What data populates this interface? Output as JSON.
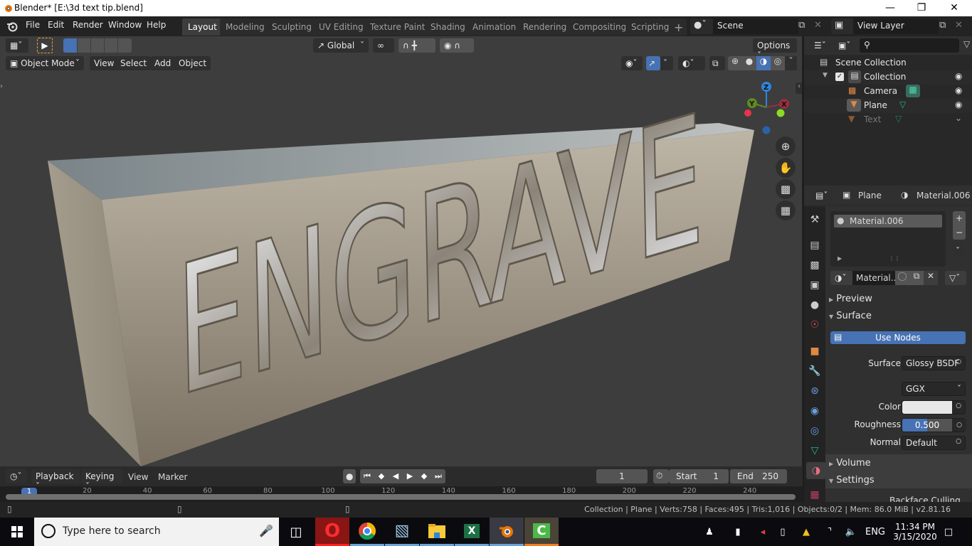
{
  "window": {
    "title": "Blender* [E:\\3d text tip.blend]",
    "minimize_icon": "minimize-icon",
    "maximize_icon": "restore-icon",
    "close_icon": "close-icon"
  },
  "topbar": {
    "menus": [
      "File",
      "Edit",
      "Render",
      "Window",
      "Help"
    ],
    "workspaces": [
      "Layout",
      "Modeling",
      "Sculpting",
      "UV Editing",
      "Texture Paint",
      "Shading",
      "Animation",
      "Rendering",
      "Compositing",
      "Scripting"
    ],
    "active_workspace": "Layout",
    "add_workspace": "+",
    "scene": "Scene",
    "view_layer": "View Layer"
  },
  "viewport": {
    "transform_orientation": "Global",
    "options_label": "Options",
    "mode": "Object Mode",
    "menus": [
      "View",
      "Select",
      "Add",
      "Object"
    ],
    "gizmo": {
      "x": "X",
      "y": "Y",
      "z": "Z",
      "x_color": "#c8334b",
      "y_color": "#5f8a1f",
      "z_color": "#2e86de"
    },
    "scene_text": "ENGRAVE"
  },
  "outliner": {
    "search_placeholder": "",
    "root": "Scene Collection",
    "items": [
      {
        "name": "Collection",
        "type": "collection",
        "visible": true
      },
      {
        "name": "Camera",
        "type": "camera",
        "visible": true
      },
      {
        "name": "Plane",
        "type": "mesh",
        "visible": true,
        "selected": true
      },
      {
        "name": "Text",
        "type": "mesh",
        "visible": false
      }
    ]
  },
  "properties": {
    "breadcrumb_object": "Plane",
    "breadcrumb_material": "Material.006",
    "material_slots": [
      "Material.006"
    ],
    "material_name": "Material..",
    "sections": {
      "preview": "Preview",
      "surface": "Surface",
      "volume": "Volume",
      "settings": "Settings"
    },
    "use_nodes_label": "Use Nodes",
    "fields": {
      "surface_label": "Surface",
      "surface_value": "Glossy BSDF",
      "distribution_value": "GGX",
      "color_label": "Color",
      "color_value": "#e8e8e8",
      "roughness_label": "Roughness",
      "roughness_value": "0.500",
      "roughness_fraction": 0.5,
      "normal_label": "Normal",
      "normal_value": "Default",
      "backface_label": "Backface Culling"
    }
  },
  "timeline": {
    "menus": [
      "Playback",
      "Keying",
      "View",
      "Marker"
    ],
    "current_frame": "1",
    "start_label": "Start",
    "start_value": "1",
    "end_label": "End",
    "end_value": "250",
    "ruler_ticks": [
      "1",
      "20",
      "40",
      "60",
      "80",
      "100",
      "120",
      "140",
      "160",
      "180",
      "200",
      "220",
      "240"
    ]
  },
  "statusbar": {
    "text": "Collection | Plane | Verts:758 | Faces:495 | Tris:1,016 | Objects:0/2 | Mem: 86.0 MiB | v2.81.16"
  },
  "taskbar": {
    "search_placeholder": "Type here to search",
    "apps": [
      "opera",
      "chrome",
      "notepad",
      "file-explorer",
      "excel",
      "blender",
      "camtasia"
    ],
    "language": "ENG",
    "time": "11:34 PM",
    "date": "3/15/2020"
  }
}
